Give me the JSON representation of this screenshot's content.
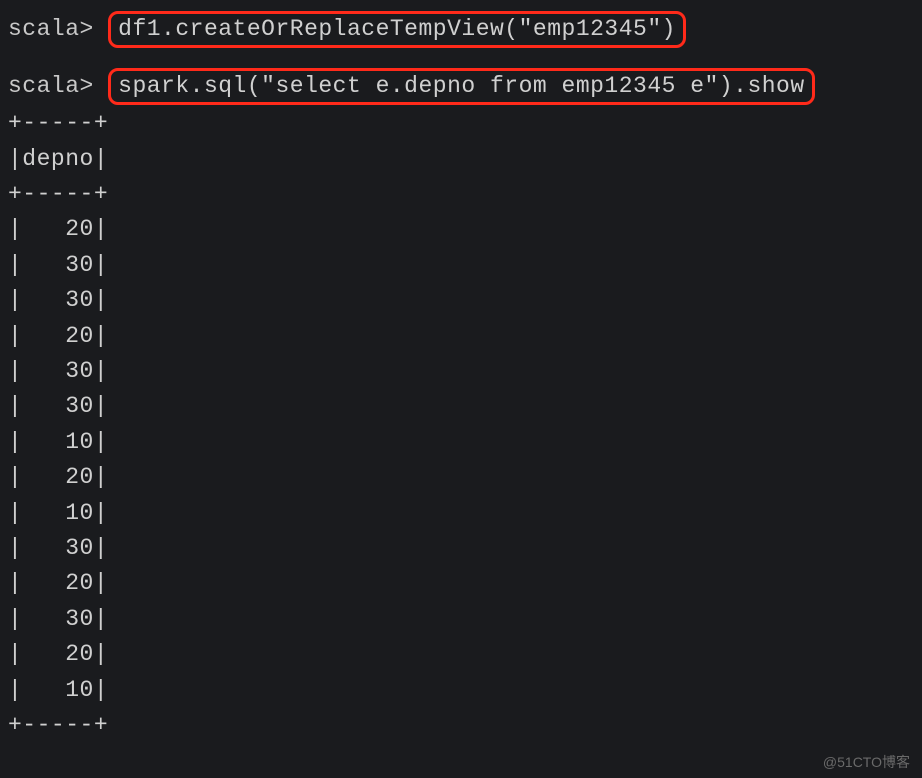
{
  "prompt": "scala>",
  "commands": {
    "cmd1": "df1.createOrReplaceTempView(\"emp12345\")",
    "cmd2": "spark.sql(\"select e.depno from emp12345 e\").show"
  },
  "table": {
    "border_top": "+-----+",
    "header": "|depno|",
    "border_mid": "+-----+",
    "rows": [
      "|   20|",
      "|   30|",
      "|   30|",
      "|   20|",
      "|   30|",
      "|   30|",
      "|   10|",
      "|   20|",
      "|   10|",
      "|   30|",
      "|   20|",
      "|   30|",
      "|   20|",
      "|   10|"
    ],
    "border_bottom": "+-----+"
  },
  "watermark": "@51CTO博客",
  "chart_data": {
    "type": "table",
    "title": "Spark SQL query result showing depno column from emp12345",
    "columns": [
      "depno"
    ],
    "rows": [
      [
        20
      ],
      [
        30
      ],
      [
        30
      ],
      [
        20
      ],
      [
        30
      ],
      [
        30
      ],
      [
        10
      ],
      [
        20
      ],
      [
        10
      ],
      [
        30
      ],
      [
        20
      ],
      [
        30
      ],
      [
        20
      ],
      [
        10
      ]
    ]
  }
}
